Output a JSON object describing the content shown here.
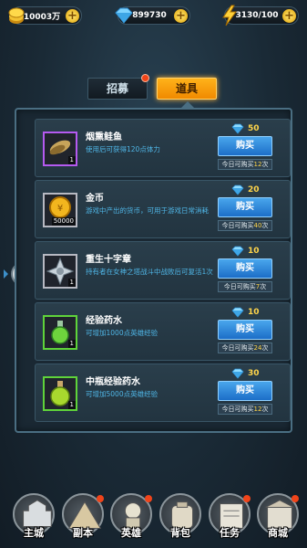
{
  "resources": {
    "gold": {
      "value": "10003万",
      "icon": "gold-coin-icon"
    },
    "gems": {
      "value": "899730",
      "icon": "diamond-icon"
    },
    "energy": {
      "value": "3130/100",
      "icon": "lightning-icon"
    }
  },
  "tabs": [
    {
      "label": "招募",
      "active": false,
      "has_alert": true
    },
    {
      "label": "道具",
      "active": true,
      "has_alert": false
    }
  ],
  "shop": {
    "buy_label": "购买",
    "limit_prefix": "今日可购买",
    "limit_suffix": "次",
    "items": [
      {
        "name": "烟熏鲑鱼",
        "desc": "使用后可获得120点体力",
        "price": "50",
        "limit": "12",
        "qty": "1",
        "frame": "purple",
        "icon": "smoked-salmon-icon"
      },
      {
        "name": "金币",
        "desc": "游戏中产出的货币，可用于游戏日常消耗",
        "price": "20",
        "limit": "40",
        "qty": "50000",
        "frame": "gray",
        "icon": "gold-coin-icon"
      },
      {
        "name": "重生十字章",
        "desc": "持有者在女神之塔战斗中战败后可复活1次",
        "price": "10",
        "limit": "7",
        "qty": "1",
        "frame": "gray",
        "icon": "cross-medal-icon"
      },
      {
        "name": "经验药水",
        "desc": "可增加1000点英雄经验",
        "price": "10",
        "limit": "24",
        "qty": "1",
        "frame": "green",
        "icon": "exp-potion-icon"
      },
      {
        "name": "中瓶经验药水",
        "desc": "可增加5000点英雄经验",
        "price": "30",
        "limit": "12",
        "qty": "1",
        "frame": "green",
        "icon": "exp-potion-medium-icon"
      }
    ]
  },
  "nav": [
    {
      "label": "主城",
      "icon": "castle-icon",
      "alert": false
    },
    {
      "label": "副本",
      "icon": "mountain-icon",
      "alert": true
    },
    {
      "label": "英雄",
      "icon": "hero-icon",
      "alert": true
    },
    {
      "label": "背包",
      "icon": "backpack-icon",
      "alert": false
    },
    {
      "label": "任务",
      "icon": "quest-scroll-icon",
      "alert": true
    },
    {
      "label": "商城",
      "icon": "shop-icon",
      "alert": true
    }
  ],
  "colors": {
    "accent_orange": "#f59a0a",
    "buy_blue": "#2b84d8",
    "desc_blue": "#4fb6e6",
    "price_gold": "#ffd54a"
  }
}
